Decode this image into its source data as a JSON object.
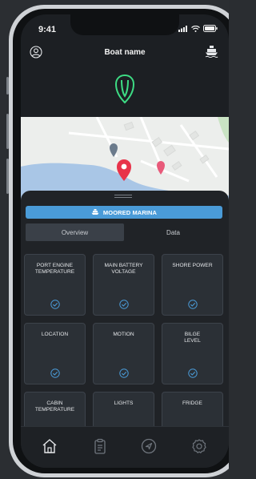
{
  "status_bar": {
    "time": "9:41"
  },
  "header": {
    "title": "Boat name",
    "left_icon": "profile-icon",
    "right_icon": "boat-icon"
  },
  "logo": {
    "icon": "shield-logo-icon",
    "color": "#3ddc84"
  },
  "banner": {
    "icon": "boat-icon",
    "label": "MOORED MARINA",
    "color": "#4a9bd8"
  },
  "tabs": [
    {
      "label": "Overview",
      "active": true
    },
    {
      "label": "Data",
      "active": false
    }
  ],
  "cards": [
    {
      "label": "PORT ENGINE\nTEMPERATURE",
      "status_icon": "check-circle-icon"
    },
    {
      "label": "MAIN BATTERY\nVOLTAGE",
      "status_icon": "check-circle-icon"
    },
    {
      "label": "SHORE POWER",
      "status_icon": "check-circle-icon"
    },
    {
      "label": "LOCATION",
      "status_icon": "check-circle-icon"
    },
    {
      "label": "MOTION",
      "status_icon": "check-circle-icon"
    },
    {
      "label": "BILGE\nLEVEL",
      "status_icon": "check-circle-icon"
    },
    {
      "label": "CABIN\nTEMPERATURE",
      "status_icon": ""
    },
    {
      "label": "LIGHTS",
      "status_icon": ""
    },
    {
      "label": "FRIDGE",
      "status_icon": ""
    }
  ],
  "navbar": {
    "items": [
      {
        "icon": "home-icon",
        "active": true
      },
      {
        "icon": "clipboard-icon",
        "active": false
      },
      {
        "icon": "navigation-icon",
        "active": false
      },
      {
        "icon": "settings-icon",
        "active": false
      }
    ]
  },
  "colors": {
    "accent": "#3ddc84",
    "check": "#4a9bd8",
    "map_pin_red": "#e8334a",
    "map_pin_grey": "#6b7b8c",
    "map_pin_pink": "#e85a7a",
    "water": "#a9c6e6"
  }
}
